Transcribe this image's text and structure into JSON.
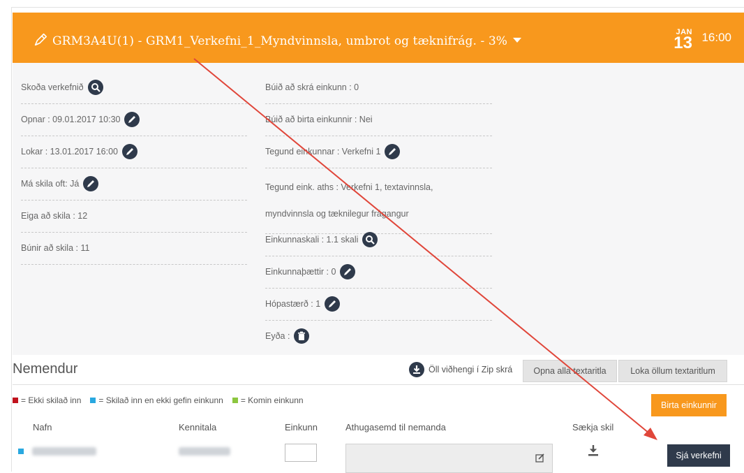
{
  "header": {
    "title": "GRM3A4U(1) - GRM1_Verkefni_1_Myndvinnsla, umbrot og tæknifrág. - 3%",
    "month": "JAN",
    "day": "13",
    "time": "16:00",
    "icons": {
      "title": "pen-icon",
      "dropdown": "chevron-down-icon"
    },
    "color": "#f8981d"
  },
  "info": {
    "left": [
      {
        "label": "Skoða verkefnið",
        "icon": "search-icon"
      },
      {
        "label": "Opnar : 09.01.2017 10:30",
        "icon": "pencil-icon"
      },
      {
        "label": "Lokar : 13.01.2017 16:00",
        "icon": "pencil-icon"
      },
      {
        "label": "Má skila oft: Já",
        "icon": "pencil-icon"
      },
      {
        "label": "Eiga að skila : 12"
      },
      {
        "label": "Búnir að skila : 11"
      }
    ],
    "right": [
      {
        "label": "Búið að skrá einkunn : 0"
      },
      {
        "label": "Búið að birta einkunnir : Nei"
      },
      {
        "label": "Tegund einkunnar : Verkefni 1",
        "icon": "pencil-icon"
      },
      {
        "label_line1": "Tegund eink. aths : Verkefni 1, textavinnsla,",
        "label_line2": "myndvinnsla og tæknilegur frágangur"
      },
      {
        "label": "Einkunnaskali : 1.1 skali",
        "icon": "search-icon"
      },
      {
        "label": "Einkunnaþættir : 0",
        "icon": "pencil-icon"
      },
      {
        "label": "Hópastærð : 1",
        "icon": "pencil-icon"
      },
      {
        "label": "Eyða :",
        "icon": "trash-icon"
      }
    ]
  },
  "students": {
    "title": "Nemendur",
    "zip_label": "Öll viðhengi í Zip skrá",
    "open_all_label": "Opna alla textaritla",
    "close_all_label": "Loka öllum textaritlum",
    "legend": [
      {
        "label": "= Ekki skilað inn",
        "color": "#c0121d"
      },
      {
        "label": "= Skilað inn en ekki gefin einkunn",
        "color": "#29a8e0"
      },
      {
        "label": "= Komin einkunn",
        "color": "#8cc63f"
      }
    ],
    "publish_label": "Birta einkunnir",
    "columns": {
      "name": "Nafn",
      "ssn": "Kennitala",
      "grade": "Einkunn",
      "comment": "Athugasemd til nemanda",
      "fetch": "Sækja skil"
    },
    "row_button_label": "Sjá verkefni"
  },
  "colors": {
    "dark": "#2f3a4b",
    "annotation_arrow": "#e0463a"
  }
}
